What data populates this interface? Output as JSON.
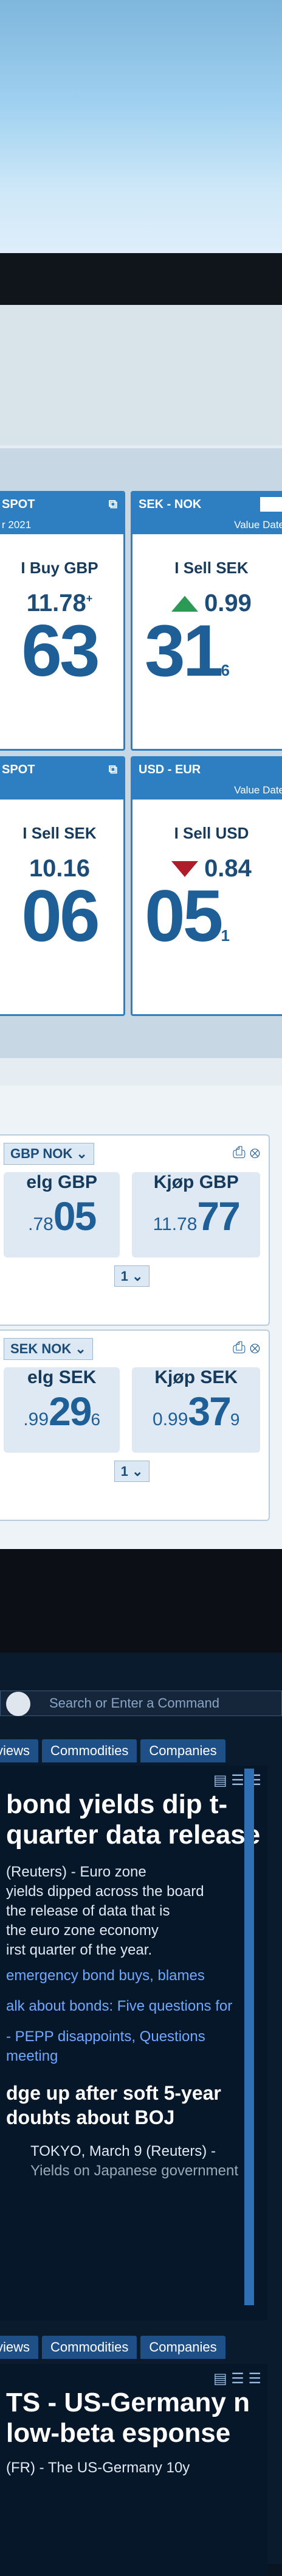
{
  "fx_tiles": [
    {
      "pair": "SPOT",
      "sub": "r 2021",
      "side": "I Buy GBP",
      "small": "11.78",
      "super": "+",
      "big": "63"
    },
    {
      "pair": "SEK - NOK",
      "sub": "Value Date",
      "side": "I Sell SEK",
      "change": "0.99",
      "dir": "up",
      "big": "31",
      "frac": "6"
    },
    {
      "pair": "SPOT",
      "sub": "",
      "side": "I Sell SEK",
      "small": "10.16",
      "big": "06"
    },
    {
      "pair": "USD - EUR",
      "sub": "Value Date",
      "side": "I Sell USD",
      "change": "0.84",
      "dir": "down",
      "big": "05",
      "frac": "1"
    }
  ],
  "blotter": [
    {
      "pair": "GBP NOK",
      "sell_label": "elg GBP",
      "sell_small": ".78",
      "sell_big": "05",
      "buy_label": "Kjøp GBP",
      "buy_small": "11.78",
      "buy_big": "77",
      "amount": "1"
    },
    {
      "pair": "SEK NOK",
      "sell_label": "elg SEK",
      "sell_small": ".99",
      "sell_big": "29",
      "sell_frac": "6",
      "buy_label": "Kjøp SEK",
      "buy_small": "0.99",
      "buy_big": "37",
      "buy_frac": "9",
      "amount": "1"
    }
  ],
  "terminal": {
    "command_placeholder": "Search or Enter a Command",
    "tabs": [
      "views",
      "Commodities",
      "Companies"
    ],
    "headline": "bond yields dip t-quarter data release",
    "body": [
      "(Reuters) - Euro zone",
      "yields dipped across the board",
      "the release of data that is",
      "the euro zone economy",
      "irst quarter of the year."
    ],
    "links": [
      "emergency bond buys, blames",
      "alk about bonds: Five questions for",
      "- PEPP disappoints, Questions",
      "meeting"
    ],
    "sub_headline": "dge up after soft 5-year doubts about BOJ",
    "dateline": "TOKYO, March 9 (Reuters) -",
    "dateline2": "Yields on Japanese government",
    "tabs2": [
      "views",
      "Commodities",
      "Companies"
    ],
    "headline2": "TS - US-Germany n low-beta esponse",
    "dateline3": "(FR) - The US-Germany 10y"
  }
}
